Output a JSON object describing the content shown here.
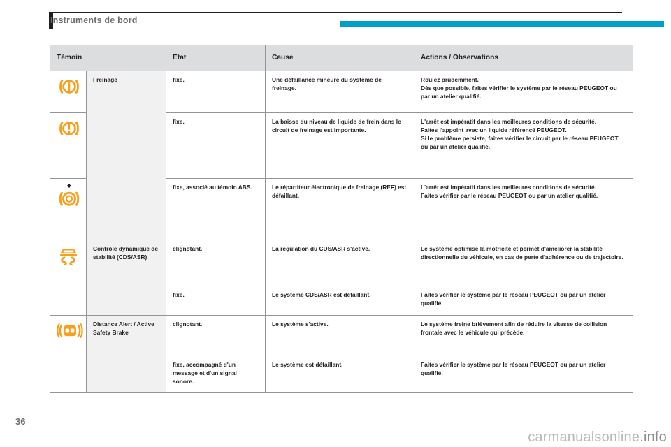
{
  "page": {
    "chapter_title": "Instruments de bord",
    "page_number": "36",
    "watermark": "carmanualsonline.info",
    "accent_color": "#00a0c6",
    "icon_color": "#f7a01d",
    "header_rule_color": "#231f20"
  },
  "table": {
    "headers": {
      "temoin": "Témoin",
      "etat": "Etat",
      "cause": "Cause",
      "actions": "Actions / Observations"
    },
    "groups": [
      {
        "name": "Freinage",
        "rows": [
          {
            "icon": "brake-warning-icon",
            "etat": "fixe.",
            "cause": "Une défaillance mineure du système de freinage.",
            "actions": "Roulez prudemment.\nDès que possible, faites vérifier le système par le réseau PEUGEOT ou par un atelier qualifié."
          },
          {
            "icon": "brake-fluid-icon",
            "etat": "fixe.",
            "cause": "La baisse du niveau de liquide de frein dans le circuit de freinage est importante.",
            "actions": "L'arrêt est impératif dans les meilleures conditions de sécurité.\nFaites l'appoint avec un liquide référencé PEUGEOT.\nSi le problème persiste, faites vérifier le circuit par le réseau PEUGEOT ou par un atelier qualifié."
          },
          {
            "icon": "brake-ref-icon",
            "etat": "fixe, associé au témoin ABS.",
            "cause": "Le répartiteur électronique de freinage (REF) est défaillant.",
            "actions": "L'arrêt est impératif dans les meilleures conditions de sécurité.\nFaites vérifier par le réseau PEUGEOT ou par un atelier qualifié."
          }
        ]
      },
      {
        "name": "Contrôle dynamique de stabilité (CDS/ASR)",
        "rows": [
          {
            "icon": "esp-skid-icon",
            "etat": "clignotant.",
            "cause": "La régulation du CDS/ASR s'active.",
            "actions": "Le système optimise la motricité et permet d'améliorer la stabilité directionnelle du véhicule, en cas de perte d'adhérence ou de trajectoire."
          },
          {
            "icon": "",
            "etat": "fixe.",
            "cause": "Le système CDS/ASR est défaillant.",
            "actions": "Faites vérifier le système par le réseau PEUGEOT ou par un atelier qualifié."
          }
        ]
      },
      {
        "name": "Distance Alert / Active Safety Brake",
        "rows": [
          {
            "icon": "distance-alert-icon",
            "etat": "clignotant.",
            "cause": "Le système s'active.",
            "actions": "Le système freine brièvement afin de réduire la vitesse de collision frontale avec le véhicule qui précède."
          },
          {
            "icon": "",
            "etat": "fixe, accompagné d'un message et d'un signal sonore.",
            "cause": "Le système est défaillant.",
            "actions": "Faites vérifier le système par le réseau PEUGEOT ou par un atelier qualifié."
          }
        ]
      }
    ]
  }
}
